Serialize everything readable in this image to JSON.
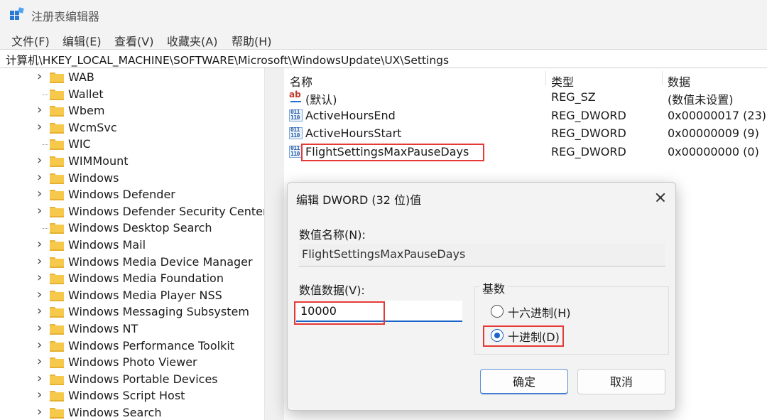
{
  "window": {
    "title": "注册表编辑器"
  },
  "menu": [
    "文件(F)",
    "编辑(E)",
    "查看(V)",
    "收藏夹(A)",
    "帮助(H)"
  ],
  "address": "计算机\\HKEY_LOCAL_MACHINE\\SOFTWARE\\Microsoft\\WindowsUpdate\\UX\\Settings",
  "tree": {
    "items": [
      {
        "label": "WAB",
        "expandable": true
      },
      {
        "label": "Wallet",
        "expandable": false
      },
      {
        "label": "Wbem",
        "expandable": true
      },
      {
        "label": "WcmSvc",
        "expandable": true
      },
      {
        "label": "WIC",
        "expandable": false
      },
      {
        "label": "WIMMount",
        "expandable": true
      },
      {
        "label": "Windows",
        "expandable": true
      },
      {
        "label": "Windows Defender",
        "expandable": true
      },
      {
        "label": "Windows Defender Security Center",
        "expandable": true
      },
      {
        "label": "Windows Desktop Search",
        "expandable": false
      },
      {
        "label": "Windows Mail",
        "expandable": true
      },
      {
        "label": "Windows Media Device Manager",
        "expandable": true
      },
      {
        "label": "Windows Media Foundation",
        "expandable": true
      },
      {
        "label": "Windows Media Player NSS",
        "expandable": true
      },
      {
        "label": "Windows Messaging Subsystem",
        "expandable": true
      },
      {
        "label": "Windows NT",
        "expandable": true
      },
      {
        "label": "Windows Performance Toolkit",
        "expandable": true
      },
      {
        "label": "Windows Photo Viewer",
        "expandable": true
      },
      {
        "label": "Windows Portable Devices",
        "expandable": true
      },
      {
        "label": "Windows Script Host",
        "expandable": true
      },
      {
        "label": "Windows Search",
        "expandable": true
      }
    ]
  },
  "list": {
    "headers": {
      "name": "名称",
      "type": "类型",
      "data": "数据"
    },
    "rows": [
      {
        "icon": "string-value-icon",
        "name": "(默认)",
        "type": "REG_SZ",
        "data": "(数值未设置)"
      },
      {
        "icon": "binary-value-icon",
        "name": "ActiveHoursEnd",
        "type": "REG_DWORD",
        "data": "0x00000017 (23)"
      },
      {
        "icon": "binary-value-icon",
        "name": "ActiveHoursStart",
        "type": "REG_DWORD",
        "data": "0x00000009 (9)"
      },
      {
        "icon": "binary-value-icon",
        "name": "FlightSettingsMaxPauseDays",
        "type": "REG_DWORD",
        "data": "0x00000000 (0)"
      }
    ]
  },
  "dialog": {
    "title": "编辑 DWORD (32 位)值",
    "value_name_label": "数值名称(N):",
    "value_name": "FlightSettingsMaxPauseDays",
    "value_data_label": "数值数据(V):",
    "value_data": "10000",
    "base_label": "基数",
    "hex_label": "十六进制(H)",
    "dec_label": "十进制(D)",
    "selected_base": "dec",
    "ok_label": "确定",
    "cancel_label": "取消"
  },
  "colors": {
    "highlight_box": "#e53935",
    "accent": "#1b64c8",
    "folder": "#f6c94c"
  }
}
